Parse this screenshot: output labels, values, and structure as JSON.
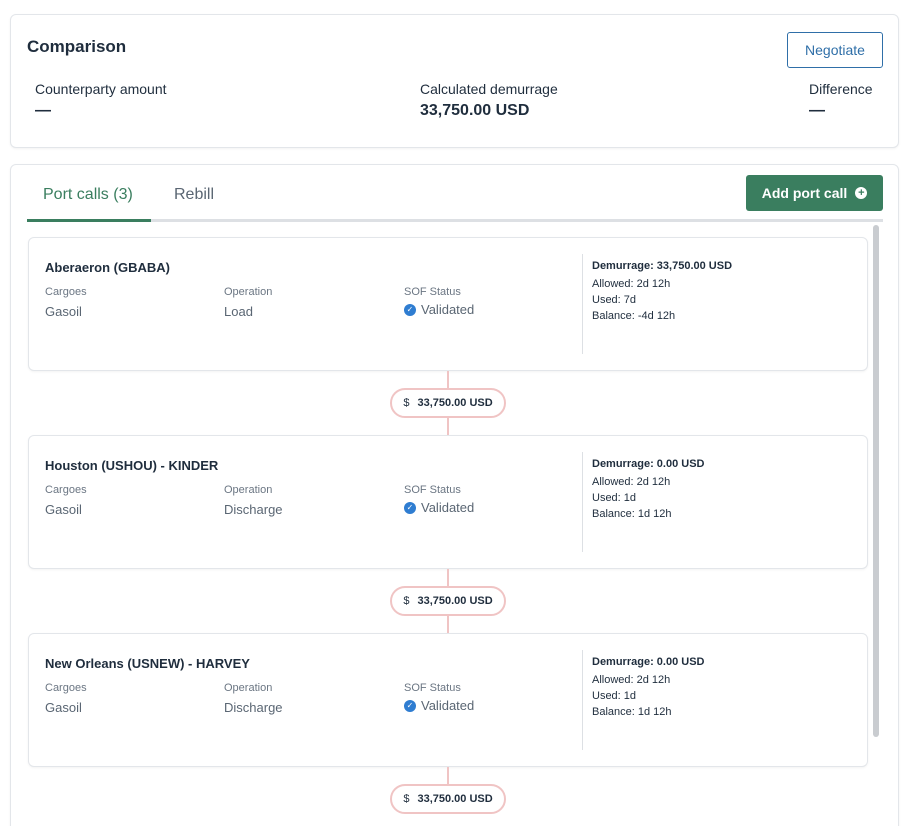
{
  "comparison": {
    "title": "Comparison",
    "negotiate_label": "Negotiate",
    "counterparty_label": "Counterparty amount",
    "counterparty_value": "—",
    "demurrage_label": "Calculated demurrage",
    "demurrage_value": "33,750.00 USD",
    "difference_label": "Difference",
    "difference_value": "—"
  },
  "tabs": {
    "port_calls": "Port calls (3)",
    "rebill": "Rebill"
  },
  "add_port_call_label": "Add port call",
  "add_icon": "plus-circle-icon",
  "check_icon": "verified-check-icon",
  "currency_symbol": "$",
  "port_calls": [
    {
      "name": "Aberaeron (GBABA)",
      "cargoes_label": "Cargoes",
      "cargoes": "Gasoil",
      "operation_label": "Operation",
      "operation": "Load",
      "sof_label": "SOF Status",
      "sof": "Validated",
      "demurrage": "Demurrage: 33,750.00 USD",
      "allowed": "Allowed: 2d 12h",
      "used": "Used: 7d",
      "balance": "Balance: -4d 12h",
      "running_total": "33,750.00 USD"
    },
    {
      "name": "Houston (USHOU) - KINDER",
      "cargoes_label": "Cargoes",
      "cargoes": "Gasoil",
      "operation_label": "Operation",
      "operation": "Discharge",
      "sof_label": "SOF Status",
      "sof": "Validated",
      "demurrage": "Demurrage: 0.00 USD",
      "allowed": "Allowed: 2d 12h",
      "used": "Used: 1d",
      "balance": "Balance: 1d 12h",
      "running_total": "33,750.00 USD"
    },
    {
      "name": "New Orleans (USNEW) - HARVEY",
      "cargoes_label": "Cargoes",
      "cargoes": "Gasoil",
      "operation_label": "Operation",
      "operation": "Discharge",
      "sof_label": "SOF Status",
      "sof": "Validated",
      "demurrage": "Demurrage: 0.00 USD",
      "allowed": "Allowed: 2d 12h",
      "used": "Used: 1d",
      "balance": "Balance: 1d 12h",
      "running_total": "33,750.00 USD"
    }
  ],
  "colors": {
    "accent_green": "#3a7e5f",
    "link_blue": "#2f6fa8",
    "pill_border": "#f0c4c4"
  }
}
